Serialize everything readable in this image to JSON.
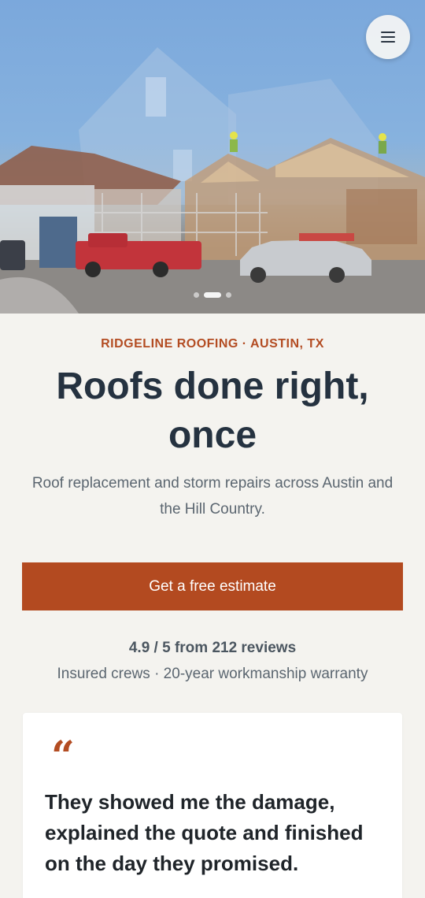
{
  "hero": {
    "image_alt": "construction-site-photo",
    "carousel": {
      "slide_count": 3,
      "active_index": 1
    }
  },
  "menu": {
    "icon": "hamburger-icon"
  },
  "eyebrow": "RIDGELINE ROOFING · AUSTIN, TX",
  "headline": "Roofs done right, once",
  "subhead": "Roof replacement and storm repairs across Austin and the Hill Country.",
  "cta": {
    "label": "Get a free estimate"
  },
  "rating": "4.9 / 5 from 212 reviews",
  "trust": "Insured crews · 20-year workmanship warranty",
  "testimonial": {
    "quote_mark": "“",
    "text": "They showed me the damage, explained the quote and finished on the day they promised."
  },
  "colors": {
    "accent": "#b34a20",
    "heading": "#253240",
    "body_bg": "#f4f3ef",
    "muted_text": "#5b6670"
  }
}
